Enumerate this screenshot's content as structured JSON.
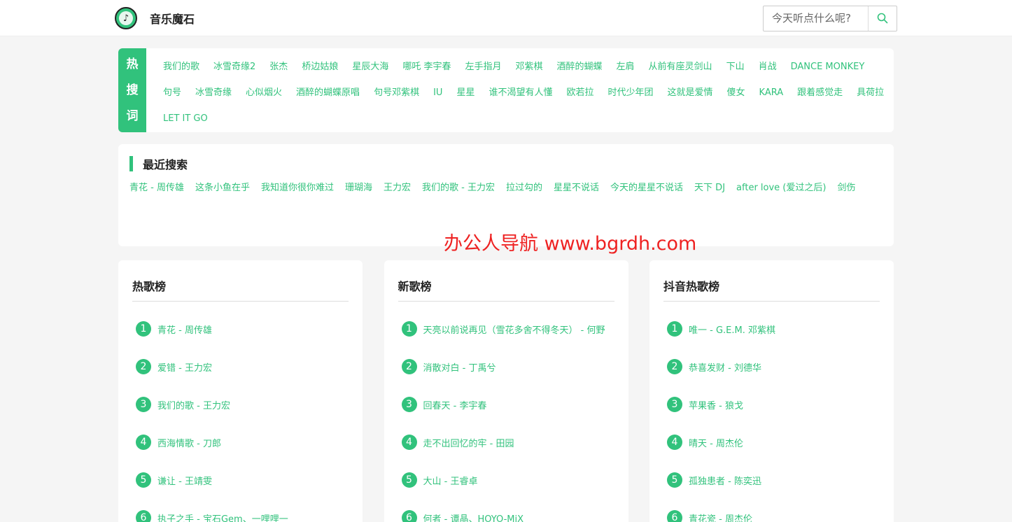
{
  "header": {
    "site_title": "音乐魔石",
    "search_placeholder": "今天听点什么呢?"
  },
  "hot": {
    "label_chars": [
      "热",
      "搜",
      "词"
    ],
    "words": [
      "我们的歌",
      "冰雪奇缘2",
      "张杰",
      "桥边姑娘",
      "星辰大海",
      "哪吒 李宇春",
      "左手指月",
      "邓紫棋",
      "酒醉的蝴蝶",
      "左肩",
      "从前有座灵剑山",
      "下山",
      "肖战",
      "DANCE MONKEY",
      "句号",
      "冰雪奇缘",
      "心似烟火",
      "酒醉的蝴蝶原唱",
      "句号邓紫棋",
      "IU",
      "星星",
      "谁不渴望有人懂",
      "欧若拉",
      "时代少年团",
      "这就是爱情",
      "傻女",
      "KARA",
      "跟着感觉走",
      "具荷拉",
      "LET IT GO"
    ]
  },
  "recent": {
    "title": "最近搜索",
    "words": [
      "青花 - 周传雄",
      "这条小鱼在乎",
      "我知道你很你难过",
      "珊瑚海",
      "王力宏",
      "我们的歌 - 王力宏",
      "拉过勾的",
      "星星不说话",
      "今天的星星不说话",
      "天下 DJ",
      "after love (爱过之后)",
      "剑伤"
    ]
  },
  "watermark": "办公人导航 www.bgrdh.com",
  "charts": [
    {
      "title": "热歌榜",
      "songs": [
        "青花 - 周传雄",
        "爱错 - 王力宏",
        "我们的歌 - 王力宏",
        "西海情歌 - 刀郎",
        "谦让 - 王靖雯",
        "执子之手 - 宝石Gem、一哩哩一"
      ]
    },
    {
      "title": "新歌榜",
      "songs": [
        "天亮以前说再见（雪花多舍不得冬天） - 何野",
        "消散对白 - 丁禹兮",
        "回春天 - 李宇春",
        "走不出回忆的牢 - 田园",
        "大山 - 王睿卓",
        "何者 - 谭晶、HOYO-MiX"
      ]
    },
    {
      "title": "抖音热歌榜",
      "songs": [
        "唯一 - G.E.M. 邓紫棋",
        "恭喜发财 - 刘德华",
        "苹果香 - 狼戈",
        "晴天 - 周杰伦",
        "孤独患者 - 陈奕迅",
        "青花瓷 - 周杰伦"
      ]
    }
  ],
  "colors": {
    "accent": "#31c27c",
    "watermark": "#e22222"
  }
}
